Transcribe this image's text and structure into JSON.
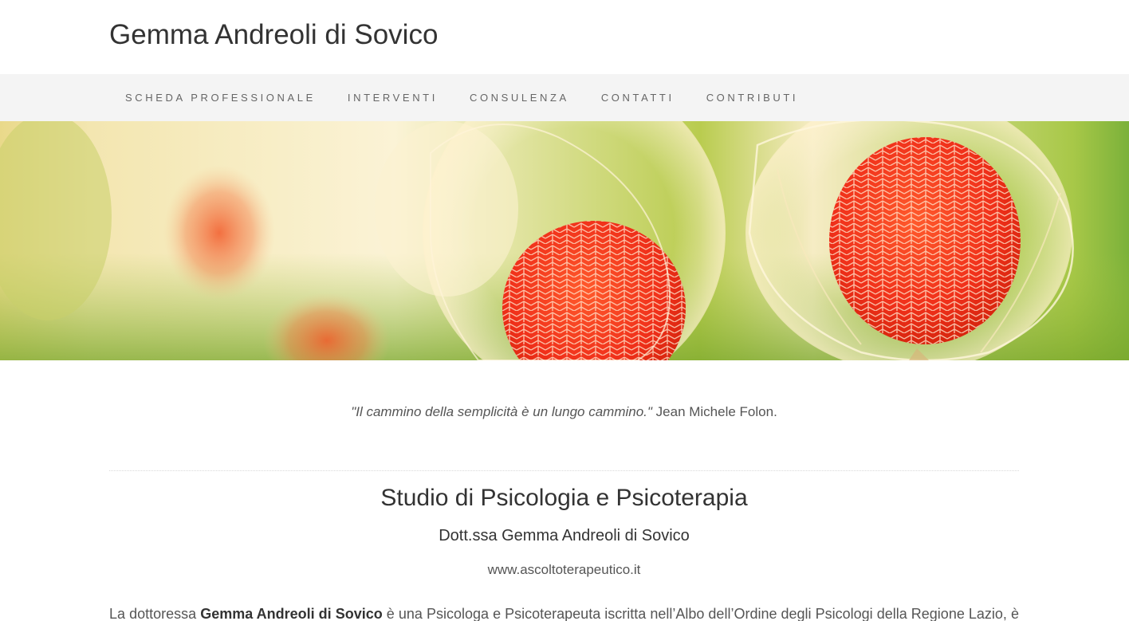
{
  "header": {
    "site_title": "Gemma Andreoli di Sovico"
  },
  "nav": {
    "items": [
      {
        "label": "SCHEDA PROFESSIONALE"
      },
      {
        "label": "INTERVENTI"
      },
      {
        "label": "CONSULENZA"
      },
      {
        "label": "CONTATTI"
      },
      {
        "label": "CONTRIBUTI"
      }
    ]
  },
  "hero": {
    "image": "physalis-lanterns-photo"
  },
  "quote": {
    "text": "\"Il cammino della semplicità è un lungo cammino.\"",
    "author": " Jean Michele Folon."
  },
  "main": {
    "title": "Studio di Psicologia e Psicoterapia",
    "subtitle": "Dott.ssa Gemma Andreoli di Sovico",
    "website": "www.ascoltoterapeutico.it",
    "intro_prefix": "La dottoressa ",
    "intro_name": "Gemma Andreoli di Sovico",
    "intro_rest": " è una Psicologa e Psicoterapeuta iscritta nell’Albo dell’Ordine degli Psicologi della Regione Lazio, è"
  },
  "colors": {
    "nav_background": "#f4f4f4",
    "text": "#333333",
    "hero_green": "#7bb13a",
    "hero_red": "#f23a17"
  }
}
